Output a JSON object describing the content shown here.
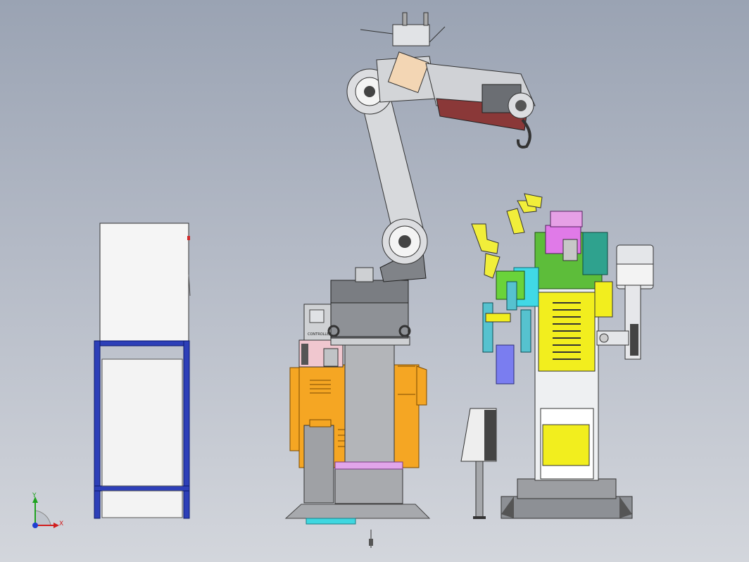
{
  "viewport": {
    "triad": {
      "x_label": "X",
      "y_label": "Y",
      "x_color": "#d11e1e",
      "y_color": "#1fa31f",
      "z_color": "#1f3ed1"
    }
  },
  "scene": {
    "background_top": "#9aa3b3",
    "background_bottom": "#d3d6dc",
    "colors": {
      "frame_blue": "#2d3fb8",
      "cabinet_white": "#f4f4f4",
      "base_orange": "#f5a623",
      "robot_grey": "#c9ccd1",
      "fixture_yellow": "#f2ee1e",
      "pink_part": "#e8a0e8",
      "cyan_part": "#38c9d6"
    },
    "robot_controller_label": "CONTROLLER"
  }
}
